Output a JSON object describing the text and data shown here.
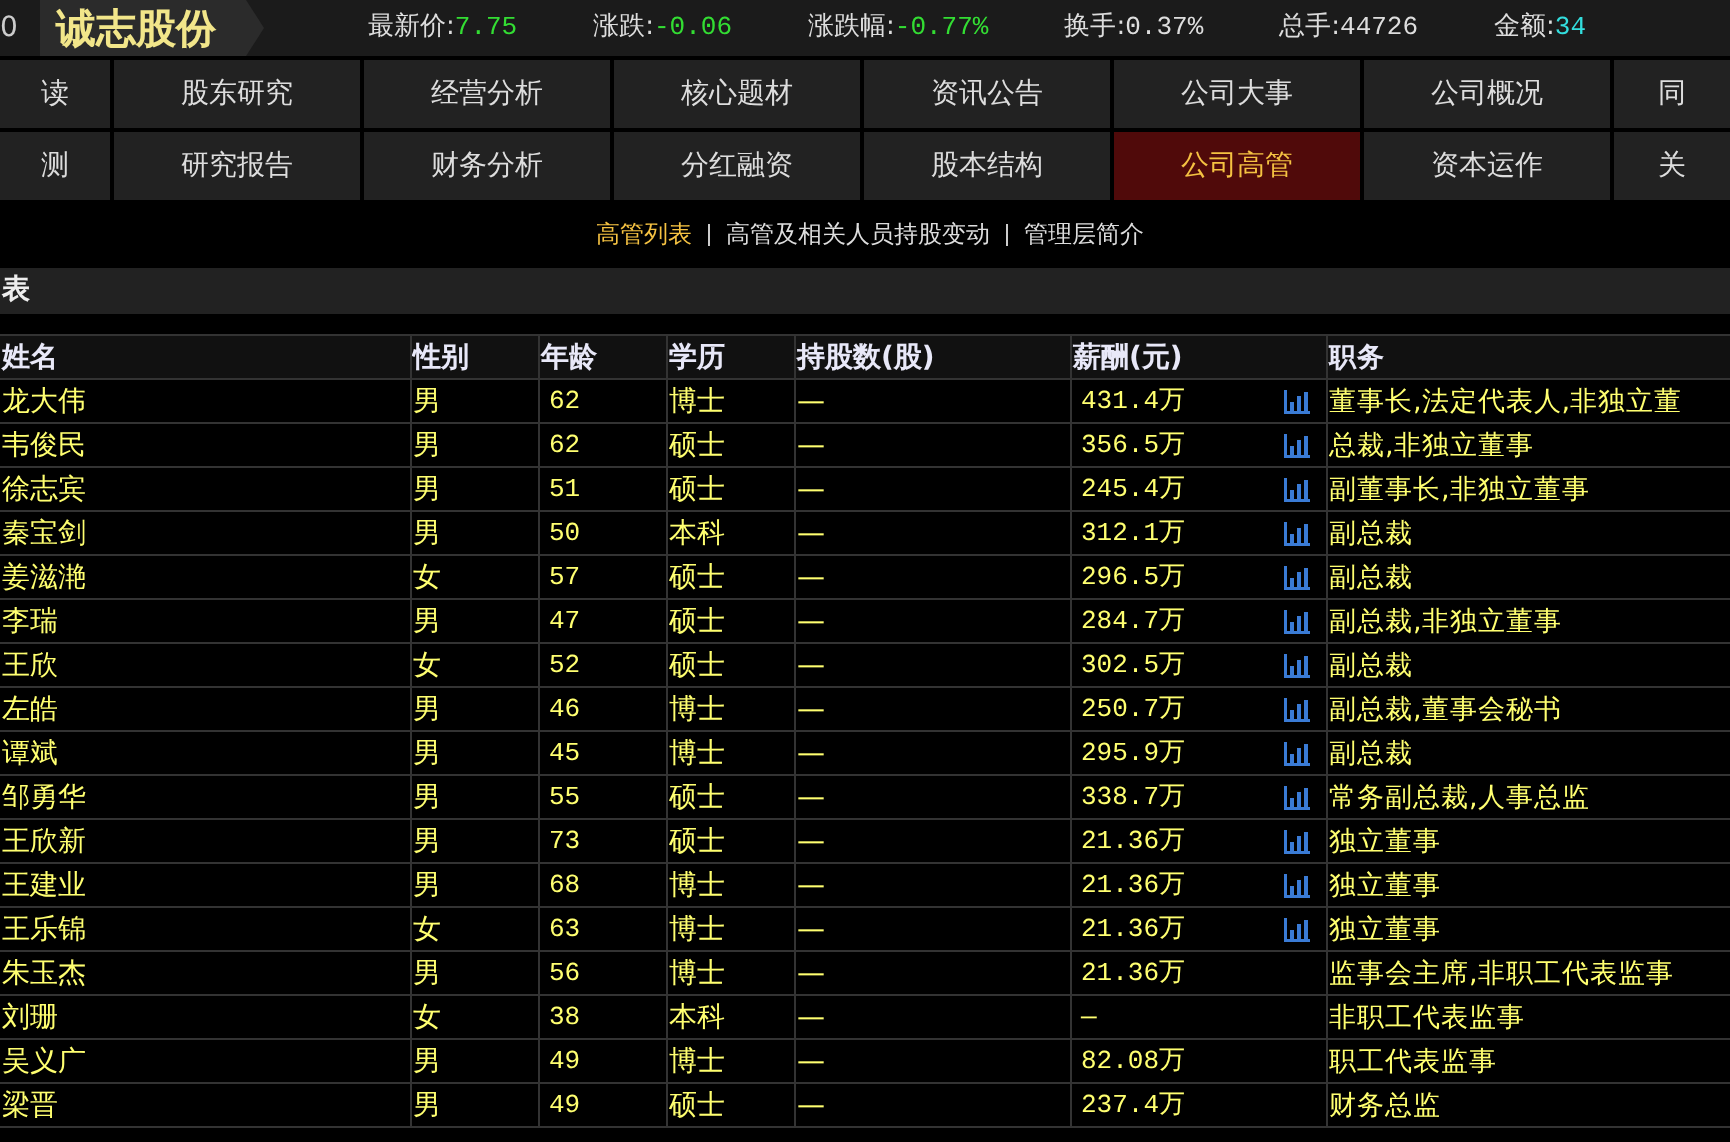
{
  "quote_bar": {
    "code": "0",
    "name": "诚志股份",
    "items": [
      {
        "label": "最新价:",
        "value": "7.75",
        "color": "#33dd33"
      },
      {
        "label": "涨跌:",
        "value": "-0.06",
        "color": "#33dd33"
      },
      {
        "label": "涨跌幅:",
        "value": "-0.77%",
        "color": "#33dd33"
      },
      {
        "label": "换手:",
        "value": "0.37%",
        "color": "#dddddd"
      },
      {
        "label": "总手:",
        "value": "44726",
        "color": "#dddddd"
      },
      {
        "label": "金额:",
        "value": "34",
        "color": "#33dddd"
      }
    ]
  },
  "nav_rows": [
    [
      {
        "label": "读",
        "selected": false
      },
      {
        "label": "股东研究",
        "selected": false
      },
      {
        "label": "经营分析",
        "selected": false
      },
      {
        "label": "核心题材",
        "selected": false
      },
      {
        "label": "资讯公告",
        "selected": false
      },
      {
        "label": "公司大事",
        "selected": false
      },
      {
        "label": "公司概况",
        "selected": false
      },
      {
        "label": "同",
        "selected": false
      }
    ],
    [
      {
        "label": "测",
        "selected": false
      },
      {
        "label": "研究报告",
        "selected": false
      },
      {
        "label": "财务分析",
        "selected": false
      },
      {
        "label": "分红融资",
        "selected": false
      },
      {
        "label": "股本结构",
        "selected": false
      },
      {
        "label": "公司高管",
        "selected": true
      },
      {
        "label": "资本运作",
        "selected": false
      },
      {
        "label": "关",
        "selected": false
      }
    ]
  ],
  "sub_tabs": [
    {
      "label": "高管列表",
      "selected": true
    },
    {
      "label": "高管及相关人员持股变动",
      "selected": false
    },
    {
      "label": "管理层简介",
      "selected": false
    }
  ],
  "section_title": "表",
  "table": {
    "columns": [
      "姓名",
      "性别",
      "年龄",
      "学历",
      "持股数(股)",
      "薪酬(元)",
      "职务"
    ],
    "rows": [
      {
        "cells": [
          "龙大伟",
          "男",
          "62",
          "博士",
          "—",
          "431.4万",
          "董事长,法定代表人,非独立董"
        ],
        "has_chart": true
      },
      {
        "cells": [
          "韦俊民",
          "男",
          "62",
          "硕士",
          "—",
          "356.5万",
          "总裁,非独立董事"
        ],
        "has_chart": true
      },
      {
        "cells": [
          "徐志宾",
          "男",
          "51",
          "硕士",
          "—",
          "245.4万",
          "副董事长,非独立董事"
        ],
        "has_chart": true
      },
      {
        "cells": [
          "秦宝剑",
          "男",
          "50",
          "本科",
          "—",
          "312.1万",
          "副总裁"
        ],
        "has_chart": true
      },
      {
        "cells": [
          "姜滋滟",
          "女",
          "57",
          "硕士",
          "—",
          "296.5万",
          "副总裁"
        ],
        "has_chart": true
      },
      {
        "cells": [
          "李瑞",
          "男",
          "47",
          "硕士",
          "—",
          "284.7万",
          "副总裁,非独立董事"
        ],
        "has_chart": true
      },
      {
        "cells": [
          "王欣",
          "女",
          "52",
          "硕士",
          "—",
          "302.5万",
          "副总裁"
        ],
        "has_chart": true
      },
      {
        "cells": [
          "左皓",
          "男",
          "46",
          "博士",
          "—",
          "250.7万",
          "副总裁,董事会秘书"
        ],
        "has_chart": true
      },
      {
        "cells": [
          "谭斌",
          "男",
          "45",
          "博士",
          "—",
          "295.9万",
          "副总裁"
        ],
        "has_chart": true
      },
      {
        "cells": [
          "邹勇华",
          "男",
          "55",
          "硕士",
          "—",
          "338.7万",
          "常务副总裁,人事总监"
        ],
        "has_chart": true
      },
      {
        "cells": [
          "王欣新",
          "男",
          "73",
          "硕士",
          "—",
          "21.36万",
          "独立董事"
        ],
        "has_chart": true
      },
      {
        "cells": [
          "王建业",
          "男",
          "68",
          "博士",
          "—",
          "21.36万",
          "独立董事"
        ],
        "has_chart": true
      },
      {
        "cells": [
          "王乐锦",
          "女",
          "63",
          "博士",
          "—",
          "21.36万",
          "独立董事"
        ],
        "has_chart": true
      },
      {
        "cells": [
          "朱玉杰",
          "男",
          "56",
          "博士",
          "—",
          "21.36万",
          "监事会主席,非职工代表监事"
        ],
        "has_chart": false
      },
      {
        "cells": [
          "刘珊",
          "女",
          "38",
          "本科",
          "—",
          "—",
          "非职工代表监事"
        ],
        "has_chart": false
      },
      {
        "cells": [
          "吴义广",
          "男",
          "49",
          "博士",
          "—",
          "82.08万",
          "职工代表监事"
        ],
        "has_chart": false
      },
      {
        "cells": [
          "梁晋",
          "男",
          "49",
          "硕士",
          "—",
          "237.4万",
          "财务总监"
        ],
        "has_chart": false
      }
    ]
  }
}
